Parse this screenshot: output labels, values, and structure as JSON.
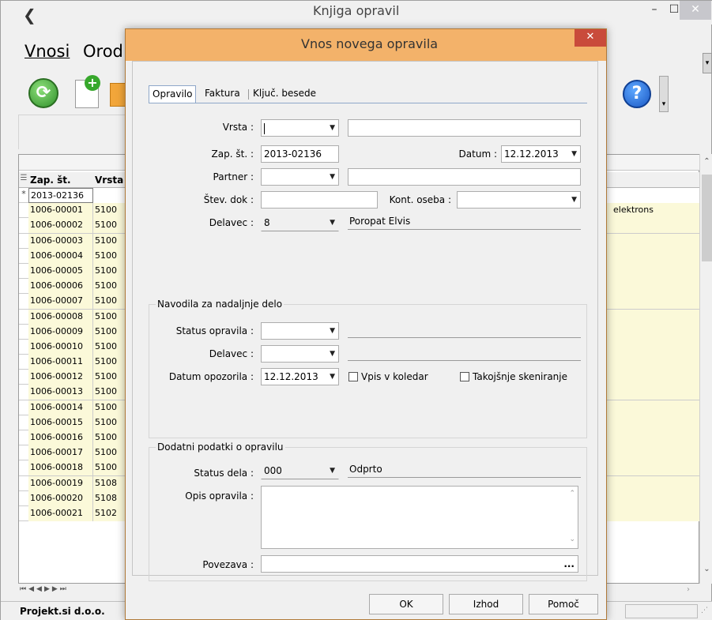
{
  "main_window": {
    "title": "Knjiga opravil",
    "menu": [
      "Vnosi",
      "Orod"
    ],
    "window_buttons": {
      "minimize": "–",
      "maximize": "☐",
      "close": "✕"
    },
    "toolbar_icons": [
      "refresh-icon",
      "new-document-icon",
      "help-icon"
    ],
    "grid": {
      "columns": [
        "Zap. št.",
        "Vrsta"
      ],
      "rows": [
        {
          "marker": "*",
          "zap": "2013-02136",
          "vrsta": "",
          "right": ""
        },
        {
          "marker": "",
          "zap": "1006-00001",
          "vrsta": "5100",
          "right": "elektrons"
        },
        {
          "marker": "",
          "zap": "1006-00002",
          "vrsta": "5100",
          "right": ""
        },
        {
          "marker": "",
          "zap": "1006-00003",
          "vrsta": "5100",
          "right": ""
        },
        {
          "marker": "",
          "zap": "1006-00004",
          "vrsta": "5100",
          "right": ""
        },
        {
          "marker": "",
          "zap": "1006-00005",
          "vrsta": "5100",
          "right": ""
        },
        {
          "marker": "",
          "zap": "1006-00006",
          "vrsta": "5100",
          "right": ""
        },
        {
          "marker": "",
          "zap": "1006-00007",
          "vrsta": "5100",
          "right": ""
        },
        {
          "marker": "",
          "zap": "1006-00008",
          "vrsta": "5100",
          "right": ""
        },
        {
          "marker": "",
          "zap": "1006-00009",
          "vrsta": "5100",
          "right": ""
        },
        {
          "marker": "",
          "zap": "1006-00010",
          "vrsta": "5100",
          "right": ""
        },
        {
          "marker": "",
          "zap": "1006-00011",
          "vrsta": "5100",
          "right": ""
        },
        {
          "marker": "",
          "zap": "1006-00012",
          "vrsta": "5100",
          "right": ""
        },
        {
          "marker": "",
          "zap": "1006-00013",
          "vrsta": "5100",
          "right": ""
        },
        {
          "marker": "",
          "zap": "1006-00014",
          "vrsta": "5100",
          "right": ""
        },
        {
          "marker": "",
          "zap": "1006-00015",
          "vrsta": "5100",
          "right": ""
        },
        {
          "marker": "",
          "zap": "1006-00016",
          "vrsta": "5100",
          "right": ""
        },
        {
          "marker": "",
          "zap": "1006-00017",
          "vrsta": "5100",
          "right": ""
        },
        {
          "marker": "",
          "zap": "1006-00018",
          "vrsta": "5100",
          "right": ""
        },
        {
          "marker": "",
          "zap": "1006-00019",
          "vrsta": "5108",
          "right": ""
        },
        {
          "marker": "",
          "zap": "1006-00020",
          "vrsta": "5108",
          "right": ""
        },
        {
          "marker": "",
          "zap": "1006-00021",
          "vrsta": "5102",
          "right": ""
        }
      ]
    },
    "status_company": "Projekt.si d.o.o."
  },
  "dialog": {
    "title": "Vnos novega opravila",
    "close": "✕",
    "tabs": [
      "Opravilo",
      "Faktura",
      "Ključ. besede"
    ],
    "active_tab": "Opravilo",
    "fields": {
      "vrsta_label": "Vrsta :",
      "vrsta_value": "",
      "vrsta_desc": "",
      "zap_label": "Zap. št. :",
      "zap_value": "2013-02136",
      "datum_label": "Datum :",
      "datum_value": "12.12.2013",
      "partner_label": "Partner :",
      "partner_value": "",
      "partner_desc": "",
      "stev_dok_label": "Štev. dok :",
      "stev_dok_value": "",
      "kont_oseba_label": "Kont. oseba :",
      "kont_oseba_value": "",
      "delavec_label": "Delavec :",
      "delavec_value": "8",
      "delavec_name": "Poropat Elvis"
    },
    "navodila": {
      "title": "Navodila za nadaljnje delo",
      "status_label": "Status opravila :",
      "status_value": "",
      "delavec_label": "Delavec :",
      "delavec_value": "",
      "datum_opozorila_label": "Datum opozorila :",
      "datum_opozorila_value": "12.12.2013",
      "vpis_koledar": "Vpis v koledar",
      "vpis_koledar_checked": false,
      "skeniranje": "Takojšnje skeniranje",
      "skeniranje_checked": false
    },
    "dodatni": {
      "title": "Dodatni podatki o opravilu",
      "status_dela_label": "Status dela :",
      "status_dela_value": "000",
      "status_dela_name": "Odprto",
      "opis_label": "Opis opravila :",
      "opis_value": "",
      "povezava_label": "Povezava :",
      "povezava_value": "",
      "povezava_btn": "..."
    },
    "buttons": {
      "ok": "OK",
      "izhod": "Izhod",
      "pomoc": "Pomoč"
    }
  }
}
